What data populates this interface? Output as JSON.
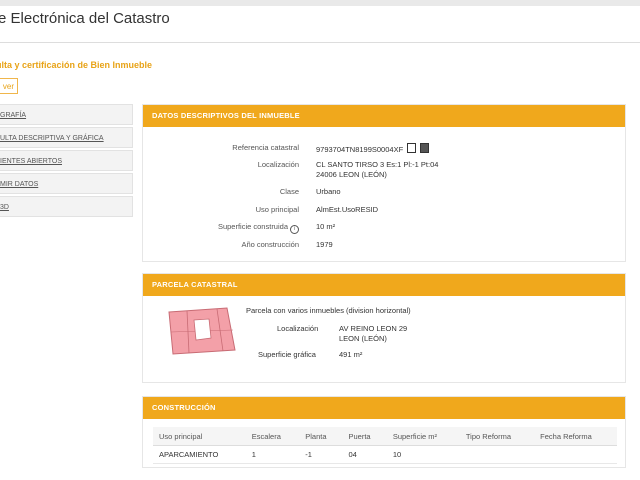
{
  "header": {
    "title": "e Electrónica del Catastro"
  },
  "page": {
    "subtitle": "ulta y certificación de Bien Inmueble",
    "back_label": "ver"
  },
  "sidebar": {
    "items": [
      {
        "label": "GRAFÍA"
      },
      {
        "label": "ULTA DESCRIPTIVA Y GRÁFICA"
      },
      {
        "label": "IENTES ABIERTOS"
      },
      {
        "label": "MIR DATOS"
      },
      {
        "label": "3D"
      }
    ]
  },
  "descriptivos": {
    "title": "DATOS DESCRIPTIVOS DEL INMUEBLE",
    "rows": [
      {
        "label": "Referencia catastral",
        "value": "9793704TN8199S0004XF"
      },
      {
        "label": "Localización",
        "value": "CL SANTO TIRSO 3 Es:1 Pl:-1 Pt:04",
        "value2": "24006 LEON (LEÓN)"
      },
      {
        "label": "Clase",
        "value": "Urbano"
      },
      {
        "label": "Uso principal",
        "value": "AlmEst.UsoRESID"
      },
      {
        "label": "Superficie construida",
        "value": "10 m²"
      },
      {
        "label": "Año construcción",
        "value": "1979"
      }
    ]
  },
  "parcela": {
    "title": "PARCELA CATASTRAL",
    "description": "Parcela con varios inmuebles (division horizontal)",
    "loc_label": "Localización",
    "loc_value": "AV REINO LEON 29",
    "loc_value2": "LEON (LEÓN)",
    "sup_label": "Superficie gráfica",
    "sup_value": "491 m²"
  },
  "construccion": {
    "title": "CONSTRUCCIÓN",
    "headers": [
      "Uso principal",
      "Escalera",
      "Planta",
      "Puerta",
      "Superficie m²",
      "Tipo Reforma",
      "Fecha Reforma"
    ],
    "rows": [
      [
        "APARCAMIENTO",
        "1",
        "-1",
        "04",
        "10",
        "",
        ""
      ]
    ]
  },
  "colors": {
    "accent": "#f0a81c",
    "subtitle": "#e8a317"
  },
  "icons": [
    "copy-icon",
    "print-icon",
    "info-icon"
  ]
}
